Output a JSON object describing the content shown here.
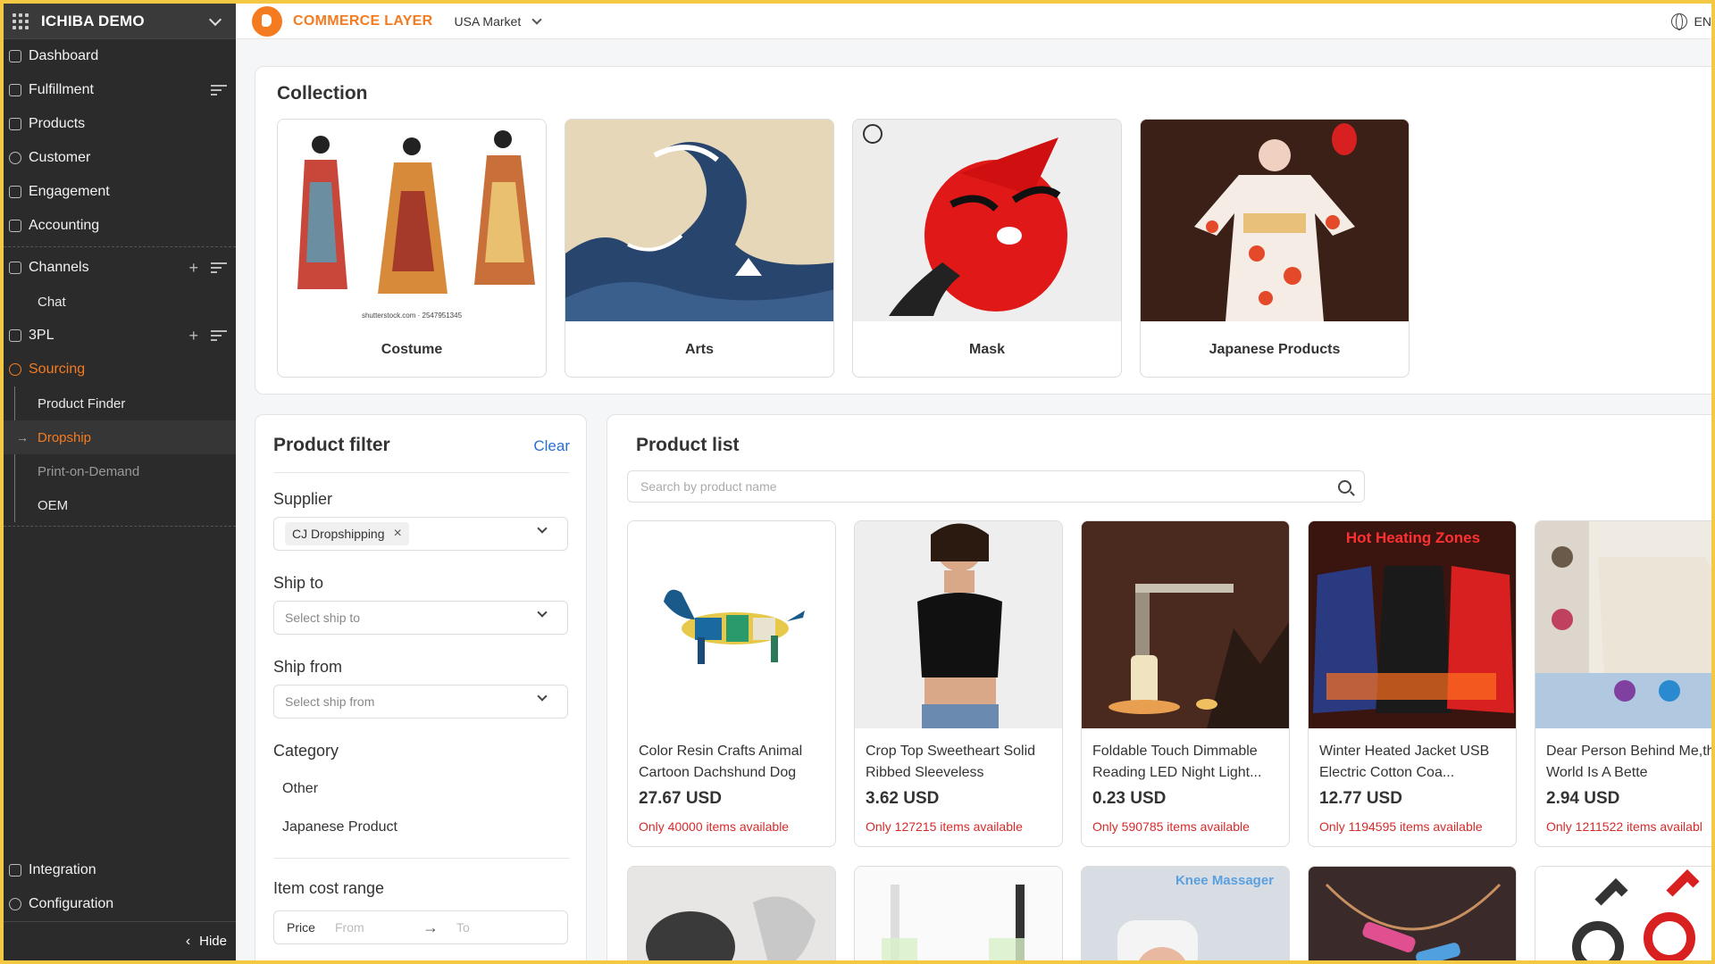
{
  "sidebar": {
    "org_name": "ICHIBA DEMO",
    "items": [
      {
        "label": "Dashboard"
      },
      {
        "label": "Fulfillment"
      },
      {
        "label": "Products"
      },
      {
        "label": "Customer"
      },
      {
        "label": "Engagement"
      },
      {
        "label": "Accounting"
      }
    ],
    "channels": {
      "label": "Channels",
      "sub": [
        "Chat"
      ]
    },
    "tpl": {
      "label": "3PL"
    },
    "sourcing": {
      "label": "Sourcing",
      "sub": [
        "Product Finder",
        "Dropship",
        "Print-on-Demand",
        "OEM"
      ],
      "active": "Dropship"
    },
    "bottom": [
      {
        "label": "Integration"
      },
      {
        "label": "Configuration"
      }
    ],
    "hide_label": "Hide"
  },
  "topbar": {
    "brand": "COMMERCE LAYER",
    "market": "USA Market",
    "lang": "EN"
  },
  "collection": {
    "title": "Collection",
    "watermark": "shutterstock.com · 2547951345",
    "items": [
      {
        "label": "Costume"
      },
      {
        "label": "Arts"
      },
      {
        "label": "Mask"
      },
      {
        "label": "Japanese Products"
      }
    ]
  },
  "filter": {
    "title": "Product filter",
    "clear_label": "Clear",
    "supplier_label": "Supplier",
    "supplier_tag": "CJ Dropshipping",
    "ship_to_label": "Ship to",
    "ship_to_placeholder": "Select ship to",
    "ship_from_label": "Ship from",
    "ship_from_placeholder": "Select ship from",
    "category_label": "Category",
    "categories": [
      "Other",
      "Japanese Product"
    ],
    "cost_range_label": "Item cost range",
    "price_label": "Price",
    "from_placeholder": "From",
    "to_placeholder": "To"
  },
  "product_list": {
    "title": "Product list",
    "search_placeholder": "Search by product name",
    "products": [
      {
        "name": "Color Resin Crafts Animal Cartoon Dachshund Dog",
        "price": "27.67 USD",
        "stock": "Only 40000 items available"
      },
      {
        "name": "Crop Top Sweetheart Solid Ribbed Sleeveless",
        "price": "3.62 USD",
        "stock": "Only 127215 items available"
      },
      {
        "name": "Foldable Touch Dimmable Reading LED Night Light...",
        "price": "0.23 USD",
        "stock": "Only 590785 items available"
      },
      {
        "name": "Winter Heated Jacket USB Electric Cotton Coa...",
        "price": "12.77 USD",
        "stock": "Only 1194595 items available"
      },
      {
        "name": "Dear Person Behind Me,the World Is A Bette",
        "price": "2.94 USD",
        "stock": "Only 1211522 items availabl"
      }
    ],
    "jacket_banner": "Hot Heating Zones",
    "knee_banner": "Knee Massager"
  },
  "colors": {
    "accent": "#f47b20",
    "link": "#2a6fd6",
    "stock_red": "#d62b2b",
    "sidebar_bg": "#2b2b2b"
  }
}
